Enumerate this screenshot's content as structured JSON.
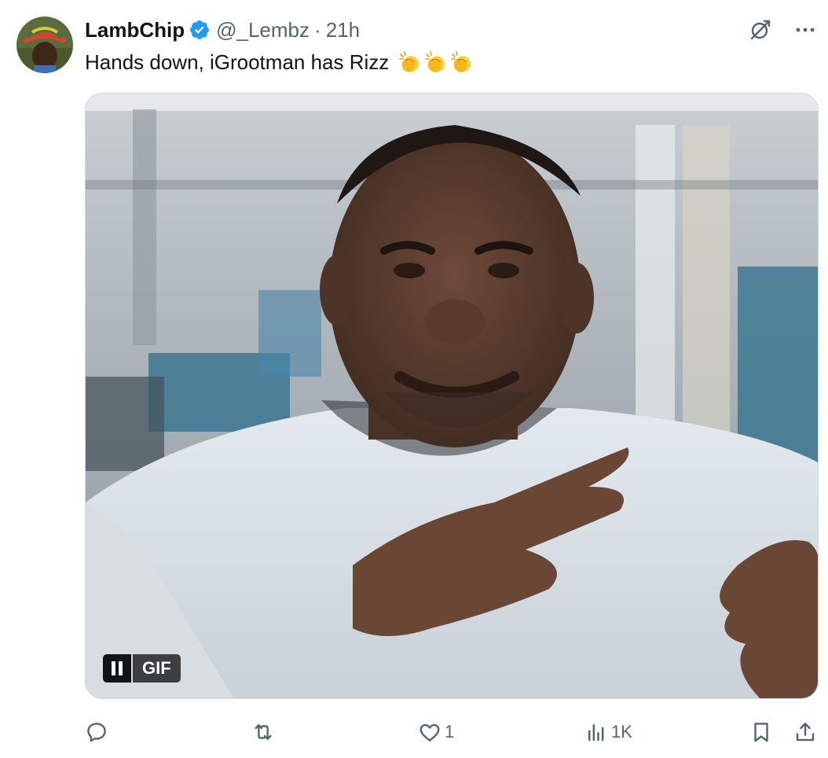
{
  "tweet": {
    "author": {
      "name": "LambChip",
      "handle": "@_Lembz",
      "separator": "·",
      "time": "21h",
      "avatar_icon": "user-avatar"
    },
    "text": "Hands down, iGrootman has Rizz",
    "emojis": [
      "clapping-hands",
      "clapping-hands",
      "clapping-hands"
    ],
    "media": {
      "type": "gif",
      "badge_label": "GIF",
      "state": "playing"
    },
    "actions": {
      "reply_count": "",
      "retweet_count": "",
      "like_count": "1",
      "views_count": "1K"
    }
  },
  "colors": {
    "verified": "#1d9bf0",
    "secondary_text": "#536471",
    "primary_text": "#0f1419"
  }
}
